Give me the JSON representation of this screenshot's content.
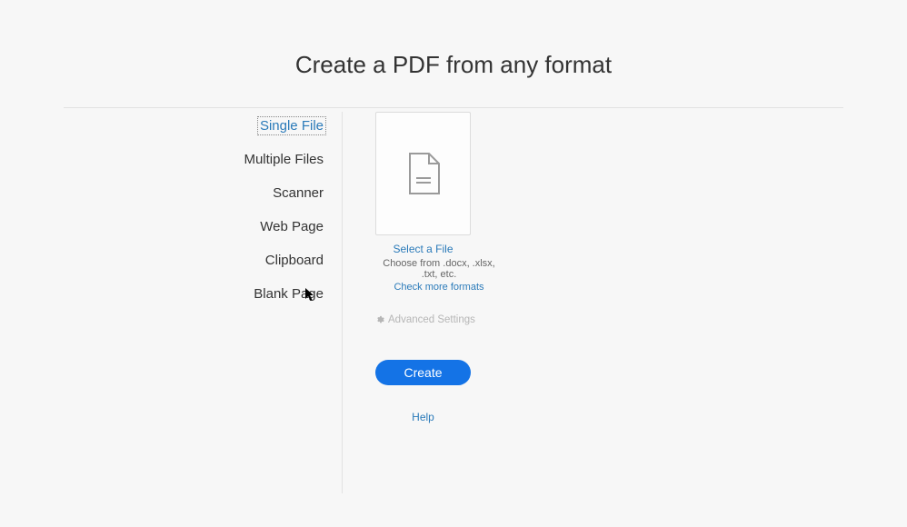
{
  "title": "Create a PDF from any format",
  "sidebar": {
    "tabs": [
      {
        "label": "Single File",
        "selected": true
      },
      {
        "label": "Multiple Files",
        "selected": false
      },
      {
        "label": "Scanner",
        "selected": false
      },
      {
        "label": "Web Page",
        "selected": false
      },
      {
        "label": "Clipboard",
        "selected": false
      },
      {
        "label": "Blank Page",
        "selected": false
      }
    ]
  },
  "content": {
    "select_file": "Select a File",
    "choose_from": "Choose from .docx, .xlsx, .txt, etc.",
    "check_formats": "Check more formats",
    "advanced_settings": "Advanced Settings",
    "create_button": "Create",
    "help": "Help"
  },
  "colors": {
    "accent": "#1473e6",
    "link": "#2a7ab9"
  }
}
